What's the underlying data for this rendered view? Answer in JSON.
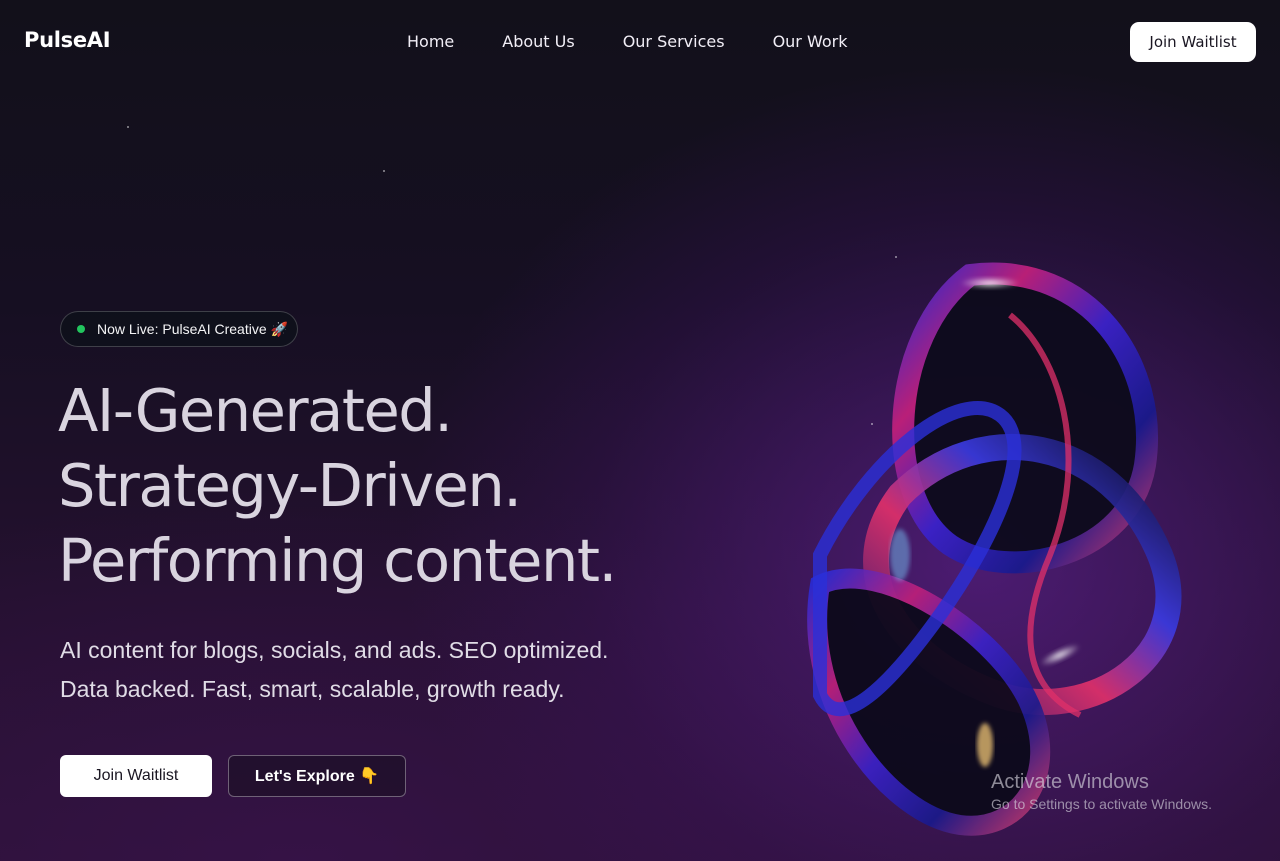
{
  "header": {
    "logo": "PulseAI",
    "nav": [
      "Home",
      "About Us",
      "Our Services",
      "Our Work"
    ],
    "cta": "Join Waitlist"
  },
  "hero": {
    "badge": "Now Live: PulseAI Creative 🚀",
    "badge_dot_color": "#22c55e",
    "headline": [
      "AI-Generated.",
      "Strategy-Driven.",
      "Performing content."
    ],
    "subtext": [
      "AI content for blogs, socials, and ads. SEO optimized.",
      "Data backed. Fast, smart, scalable, growth ready."
    ],
    "primary_button": "Join Waitlist",
    "secondary_button": "Let's Explore 👇",
    "art_icon": "abstract-3d-ring-icon"
  },
  "windows_watermark": {
    "title": "Activate Windows",
    "subtitle": "Go to Settings to activate Windows."
  },
  "colors": {
    "background": "#160f22",
    "accent_purple": "#6e24aa",
    "button_bg": "#ffffff",
    "headline_text": "#d9d4df"
  }
}
